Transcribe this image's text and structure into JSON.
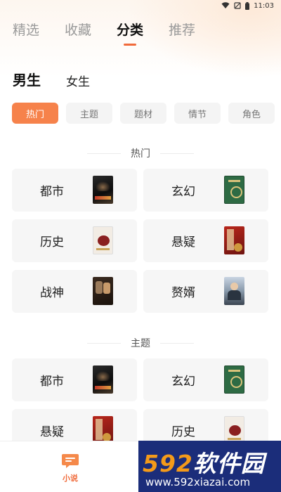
{
  "status_bar": {
    "time": "11:03"
  },
  "top_tabs": [
    {
      "label": "精选",
      "active": false
    },
    {
      "label": "收藏",
      "active": false
    },
    {
      "label": "分类",
      "active": true
    },
    {
      "label": "推荐",
      "active": false
    }
  ],
  "gender": {
    "male": "男生",
    "female": "女生"
  },
  "chips": [
    "热门",
    "主题",
    "题材",
    "情节",
    "角色"
  ],
  "sections": [
    {
      "title": "热门",
      "cards": [
        {
          "label": "都市",
          "cover": "dark"
        },
        {
          "label": "玄幻",
          "cover": "green"
        },
        {
          "label": "历史",
          "cover": "white"
        },
        {
          "label": "悬疑",
          "cover": "red"
        },
        {
          "label": "战神",
          "cover": "duo"
        },
        {
          "label": "赘婿",
          "cover": "photo"
        }
      ]
    },
    {
      "title": "主题",
      "cards": [
        {
          "label": "都市",
          "cover": "dark"
        },
        {
          "label": "玄幻",
          "cover": "green"
        },
        {
          "label": "悬疑",
          "cover": "red"
        },
        {
          "label": "历史",
          "cover": "white"
        }
      ]
    }
  ],
  "bottom_nav": {
    "novel_label": "小说"
  },
  "watermark": {
    "logo_digits": "592",
    "logo_text": "软件园",
    "url": "www.592xiazai.com"
  },
  "colors": {
    "accent": "#f06a3a",
    "chip_active": "#f6824b",
    "watermark_bg": "#1b2d7a"
  }
}
